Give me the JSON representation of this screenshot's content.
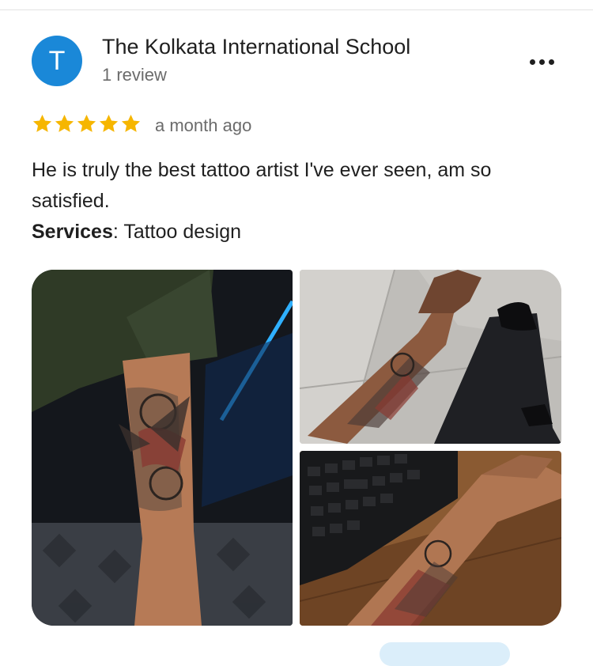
{
  "review": {
    "reviewer": {
      "avatar_letter": "T",
      "name": "The Kolkata International School",
      "review_count": "1 review"
    },
    "rating": 5,
    "timestamp": "a month ago",
    "text": "He is truly the best tattoo artist I've ever seen, am so satisfied.",
    "services": {
      "label": "Services",
      "separator": ":",
      "value": "Tattoo design"
    }
  },
  "colors": {
    "avatar": "#1a88d8",
    "star": "#f6b600",
    "secondary_text": "#6b6b6b"
  },
  "icons": {
    "more": "more-horizontal-icon",
    "star": "star-icon"
  }
}
